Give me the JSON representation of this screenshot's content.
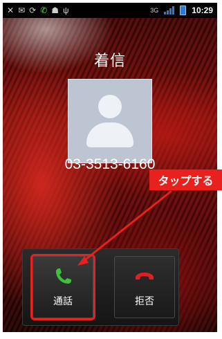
{
  "status_bar": {
    "time": "10:29",
    "icons": [
      "missed-call-icon",
      "mail-icon",
      "sync-icon",
      "phone-icon",
      "android-icon",
      "usb-icon",
      "network-3g-icon",
      "signal-icon",
      "battery-icon"
    ]
  },
  "call": {
    "title": "着信",
    "number": "03-3513-6160"
  },
  "annotation": {
    "callout": "タップする",
    "color": "#e8201e"
  },
  "buttons": {
    "answer_label": "通話",
    "decline_label": "拒否"
  },
  "colors": {
    "answer": "#3fbf3a",
    "decline": "#e02020",
    "highlight": "#e8201e"
  }
}
